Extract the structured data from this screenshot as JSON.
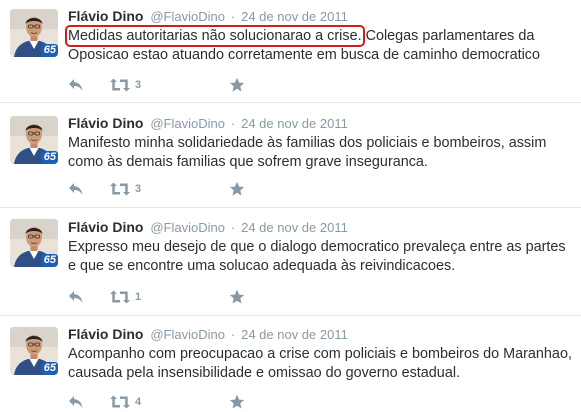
{
  "tweets": [
    {
      "name": "Flávio Dino",
      "handle": "@FlavioDino",
      "dot": "·",
      "time": "24 de nov de 2011",
      "highlight": "Medidas autoritarias não solucionarao a crise.",
      "line1_rest": " Colegas parlamentares da",
      "line2": "Oposicao estao atuando corretamente em busca de caminho democratico",
      "retweets": "3"
    },
    {
      "name": "Flávio Dino",
      "handle": "@FlavioDino",
      "dot": "·",
      "time": "24 de nov de 2011",
      "line1": "Manifesto minha solidariedade às familias dos policiais e bombeiros, assim",
      "line2": "como às demais familias que sofrem grave inseguranca.",
      "retweets": "3"
    },
    {
      "name": "Flávio Dino",
      "handle": "@FlavioDino",
      "dot": "·",
      "time": "24 de nov de 2011",
      "line1": "Expresso meu desejo de que o dialogo democratico prevaleça entre as partes",
      "line2": "e que se encontre uma solucao adequada às reivindicacoes.",
      "retweets": "1"
    },
    {
      "name": "Flávio Dino",
      "handle": "@FlavioDino",
      "dot": "·",
      "time": "24 de nov de 2011",
      "line1": "Acompanho com preocupacao a crise com policiais e bombeiros do Maranhao,",
      "line2": "causada pela insensibilidade e omissao do governo estadual.",
      "retweets": "4"
    }
  ],
  "avatar_badge": "65",
  "icons": {
    "reply": "reply-icon",
    "retweet": "retweet-icon",
    "favorite": "star-icon"
  },
  "colors": {
    "icon_gray": "#8899a6",
    "highlight_outline": "#d0201e",
    "badge_blue": "#1d5fb4"
  }
}
